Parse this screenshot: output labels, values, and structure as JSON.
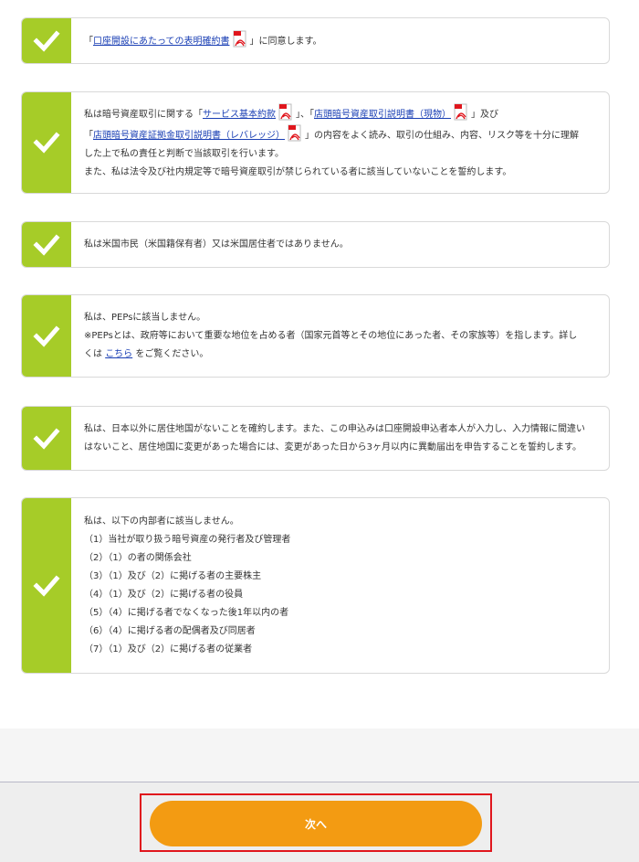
{
  "agreements": [
    {
      "lines": [
        [
          {
            "t": "「"
          },
          {
            "t": "口座開設にあたっての表明確約書",
            "link": true
          },
          {
            "pdf": true
          },
          {
            "t": "」に同意します。"
          }
        ]
      ]
    },
    {
      "lines": [
        [
          {
            "t": "私は暗号資産取引に関する「"
          },
          {
            "t": "サービス基本約款",
            "link": true
          },
          {
            "pdf": true
          },
          {
            "t": "」、「"
          },
          {
            "t": "店頭暗号資産取引説明書（現物）",
            "link": true
          },
          {
            "pdf": true
          },
          {
            "t": "」及び"
          }
        ],
        [
          {
            "t": "「"
          },
          {
            "t": "店頭暗号資産証拠金取引説明書（レバレッジ）",
            "link": true
          },
          {
            "pdf": true
          },
          {
            "t": "」の内容をよく読み、取引の仕組み、内容、リスク等を十分に理解"
          }
        ],
        [
          {
            "t": "した上で私の責任と判断で当該取引を行います。"
          }
        ],
        [
          {
            "t": "また、私は法令及び社内規定等で暗号資産取引が禁じられている者に該当していないことを誓約します。"
          }
        ]
      ]
    },
    {
      "lines": [
        [
          {
            "t": "私は米国市民（米国籍保有者）又は米国居住者ではありません。"
          }
        ]
      ]
    },
    {
      "lines": [
        [
          {
            "t": "私は、PEPsに該当しません。"
          }
        ],
        [
          {
            "t": "※PEPsとは、政府等において重要な地位を占める者（国家元首等とその地位にあった者、その家族等）を指します。詳し"
          }
        ],
        [
          {
            "t": "くは "
          },
          {
            "t": "こちら",
            "link": true
          },
          {
            "t": " をご覧ください。"
          }
        ]
      ]
    },
    {
      "lines": [
        [
          {
            "t": "私は、日本以外に居住地国がないことを確約します。また、この申込みは口座開設申込者本人が入力し、入力情報に間違い"
          }
        ],
        [
          {
            "t": "はないこと、居住地国に変更があった場合には、変更があった日から3ヶ月以内に異動届出を申告することを誓約します。"
          }
        ]
      ]
    },
    {
      "lines": [
        [
          {
            "t": "私は、以下の内部者に該当しません。"
          }
        ],
        [
          {
            "t": "（1）当社が取り扱う暗号資産の発行者及び管理者"
          }
        ],
        [
          {
            "t": "（2）（1）の者の関係会社"
          }
        ],
        [
          {
            "t": "（3）（1）及び（2）に掲げる者の主要株主"
          }
        ],
        [
          {
            "t": "（4）（1）及び（2）に掲げる者の役員"
          }
        ],
        [
          {
            "t": "（5）（4）に掲げる者でなくなった後1年以内の者"
          }
        ],
        [
          {
            "t": "（6）（4）に掲げる者の配偶者及び同居者"
          }
        ],
        [
          {
            "t": "（7）（1）及び（2）に掲げる者の従業者"
          }
        ]
      ]
    }
  ],
  "checkbox_icon": "checkmark-icon",
  "pdf_icon": "pdf-icon",
  "colors": {
    "checkbox_bg": "#a6cc28",
    "link": "#1a3fb4",
    "next_button": "#f39b12",
    "highlight": "#e0161d"
  },
  "footer": {
    "next_label": "次へ"
  }
}
